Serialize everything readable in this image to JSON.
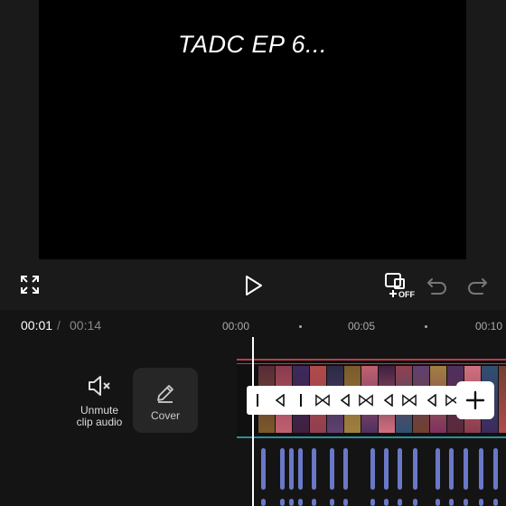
{
  "preview": {
    "caption": "TADC EP 6..."
  },
  "controls": {
    "fullscreen_icon": "fullscreen-expand-icon",
    "play_icon": "play-icon",
    "keyframe_off_label": "OFF",
    "undo_icon": "undo-icon",
    "redo_icon": "redo-icon"
  },
  "timeline": {
    "current_time": "00:01",
    "separator": "/",
    "total_time": "00:14",
    "ruler": [
      "00:00",
      "00:05",
      "00:10"
    ]
  },
  "side_actions": {
    "unmute_label_line1": "Unmute",
    "unmute_label_line2": "clip audio",
    "cover_label": "Cover"
  },
  "colors": {
    "clip_border_top": "#c03a4a",
    "clip_border_bottom": "#2a8f9a",
    "audio_waveform": "#6a78c8",
    "playhead": "#ffffff"
  }
}
